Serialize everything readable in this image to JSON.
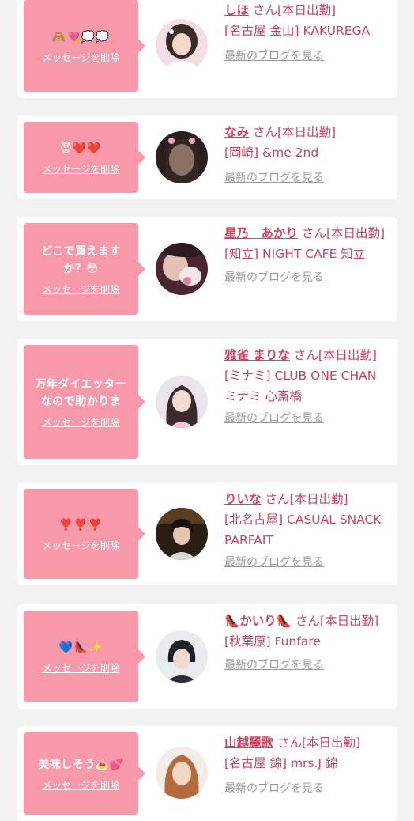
{
  "colors": {
    "accent": "#f799a8",
    "name": "#d9405f",
    "text": "#c54565",
    "link": "#9a9a9a",
    "background": "#f2f2f2"
  },
  "delete_label": "メッセージを削除",
  "blog_label": "最新のブログを見る",
  "cards": [
    {
      "message": "🙈💘💭💭",
      "name": "しほ",
      "suffix": " さん[本日出勤]",
      "shop": "[名古屋 金山] KAKUREGA"
    },
    {
      "message": "😈❤️❤️",
      "name": "なみ",
      "suffix": " さん[本日出勤]",
      "shop": "[岡崎] &me 2nd"
    },
    {
      "message": "どこで買えますか？😳",
      "name": "星乃　あかり",
      "suffix": " さん[本日出勤]",
      "shop": "[知立] NIGHT CAFE 知立"
    },
    {
      "message": "万年ダイエッターなので助かりま",
      "name": "雅雀 まりな",
      "suffix": " さん[本日出勤]",
      "shop": "[ミナミ] CLUB ONE CHAN ミナミ 心斎橋"
    },
    {
      "message": "❣️❣️❣️",
      "name": "りいな",
      "suffix": " さん[本日出勤]",
      "shop": "[北名古屋] CASUAL SNACK PARFAIT"
    },
    {
      "message": "💙👠✨",
      "name": "👠かいり👠",
      "suffix": " さん[本日出勤]",
      "shop": "[秋葉原] Funfare"
    },
    {
      "message": "美味しそう🍝💕",
      "name": "山越麗歌",
      "suffix": " さん[本日出勤]",
      "shop": "[名古屋 錦] mrs.J 錦"
    }
  ]
}
